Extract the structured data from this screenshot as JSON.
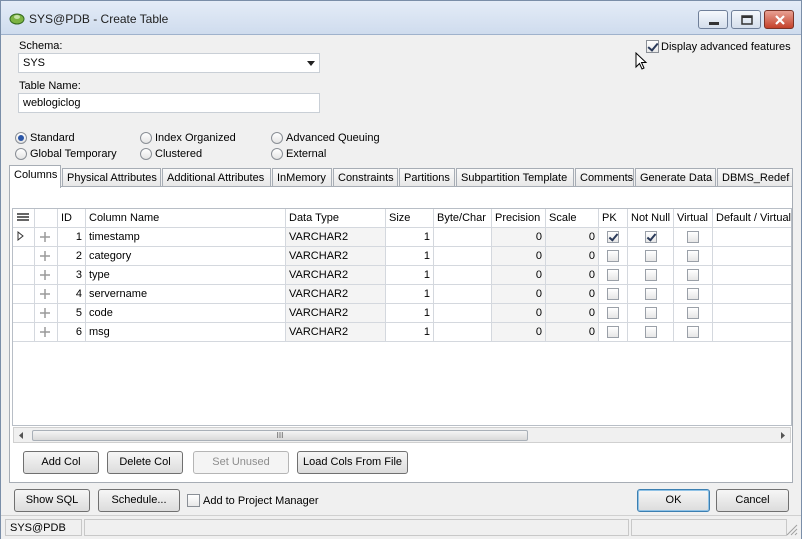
{
  "window": {
    "title": "SYS@PDB - Create Table"
  },
  "schema": {
    "label": "Schema:",
    "value": "SYS"
  },
  "advanced": {
    "label": "Display advanced features",
    "checked": true
  },
  "table_name": {
    "label": "Table Name:",
    "value": "weblogiclog"
  },
  "table_types": [
    {
      "label": "Standard",
      "selected": true
    },
    {
      "label": "Index Organized",
      "selected": false
    },
    {
      "label": "Advanced Queuing",
      "selected": false
    },
    {
      "label": "Global Temporary",
      "selected": false
    },
    {
      "label": "Clustered",
      "selected": false
    },
    {
      "label": "External",
      "selected": false
    }
  ],
  "tabs": [
    "Columns",
    "Physical Attributes",
    "Additional Attributes",
    "InMemory",
    "Constraints",
    "Partitions",
    "Subpartition Template",
    "Comments",
    "Generate Data",
    "DBMS_Redef"
  ],
  "grid": {
    "headers": [
      "ID",
      "Column Name",
      "Data Type",
      "Size",
      "Byte/Char",
      "Precision",
      "Scale",
      "PK",
      "Not Null",
      "Virtual",
      "Default / Virtual"
    ],
    "rows": [
      {
        "id": "1",
        "name": "timestamp",
        "type": "VARCHAR2",
        "size": "1",
        "byte_char": "",
        "precision": "0",
        "scale": "0",
        "pk": true,
        "not_null": true,
        "virtual": false
      },
      {
        "id": "2",
        "name": "category",
        "type": "VARCHAR2",
        "size": "1",
        "byte_char": "",
        "precision": "0",
        "scale": "0",
        "pk": false,
        "not_null": false,
        "virtual": false
      },
      {
        "id": "3",
        "name": "type",
        "type": "VARCHAR2",
        "size": "1",
        "byte_char": "",
        "precision": "0",
        "scale": "0",
        "pk": false,
        "not_null": false,
        "virtual": false
      },
      {
        "id": "4",
        "name": "servername",
        "type": "VARCHAR2",
        "size": "1",
        "byte_char": "",
        "precision": "0",
        "scale": "0",
        "pk": false,
        "not_null": false,
        "virtual": false
      },
      {
        "id": "5",
        "name": "code",
        "type": "VARCHAR2",
        "size": "1",
        "byte_char": "",
        "precision": "0",
        "scale": "0",
        "pk": false,
        "not_null": false,
        "virtual": false
      },
      {
        "id": "6",
        "name": "msg",
        "type": "VARCHAR2",
        "size": "1",
        "byte_char": "",
        "precision": "0",
        "scale": "0",
        "pk": false,
        "not_null": false,
        "virtual": false
      }
    ],
    "scroll_thumb_label": "III"
  },
  "col_buttons": {
    "add": "Add Col",
    "delete": "Delete Col",
    "set_unused": "Set Unused",
    "load": "Load Cols From File"
  },
  "bottom": {
    "show_sql": "Show SQL",
    "schedule": "Schedule...",
    "add_project_label": "Add to Project Manager",
    "add_project_checked": false,
    "ok": "OK",
    "cancel": "Cancel"
  },
  "status": {
    "connection": "SYS@PDB"
  }
}
